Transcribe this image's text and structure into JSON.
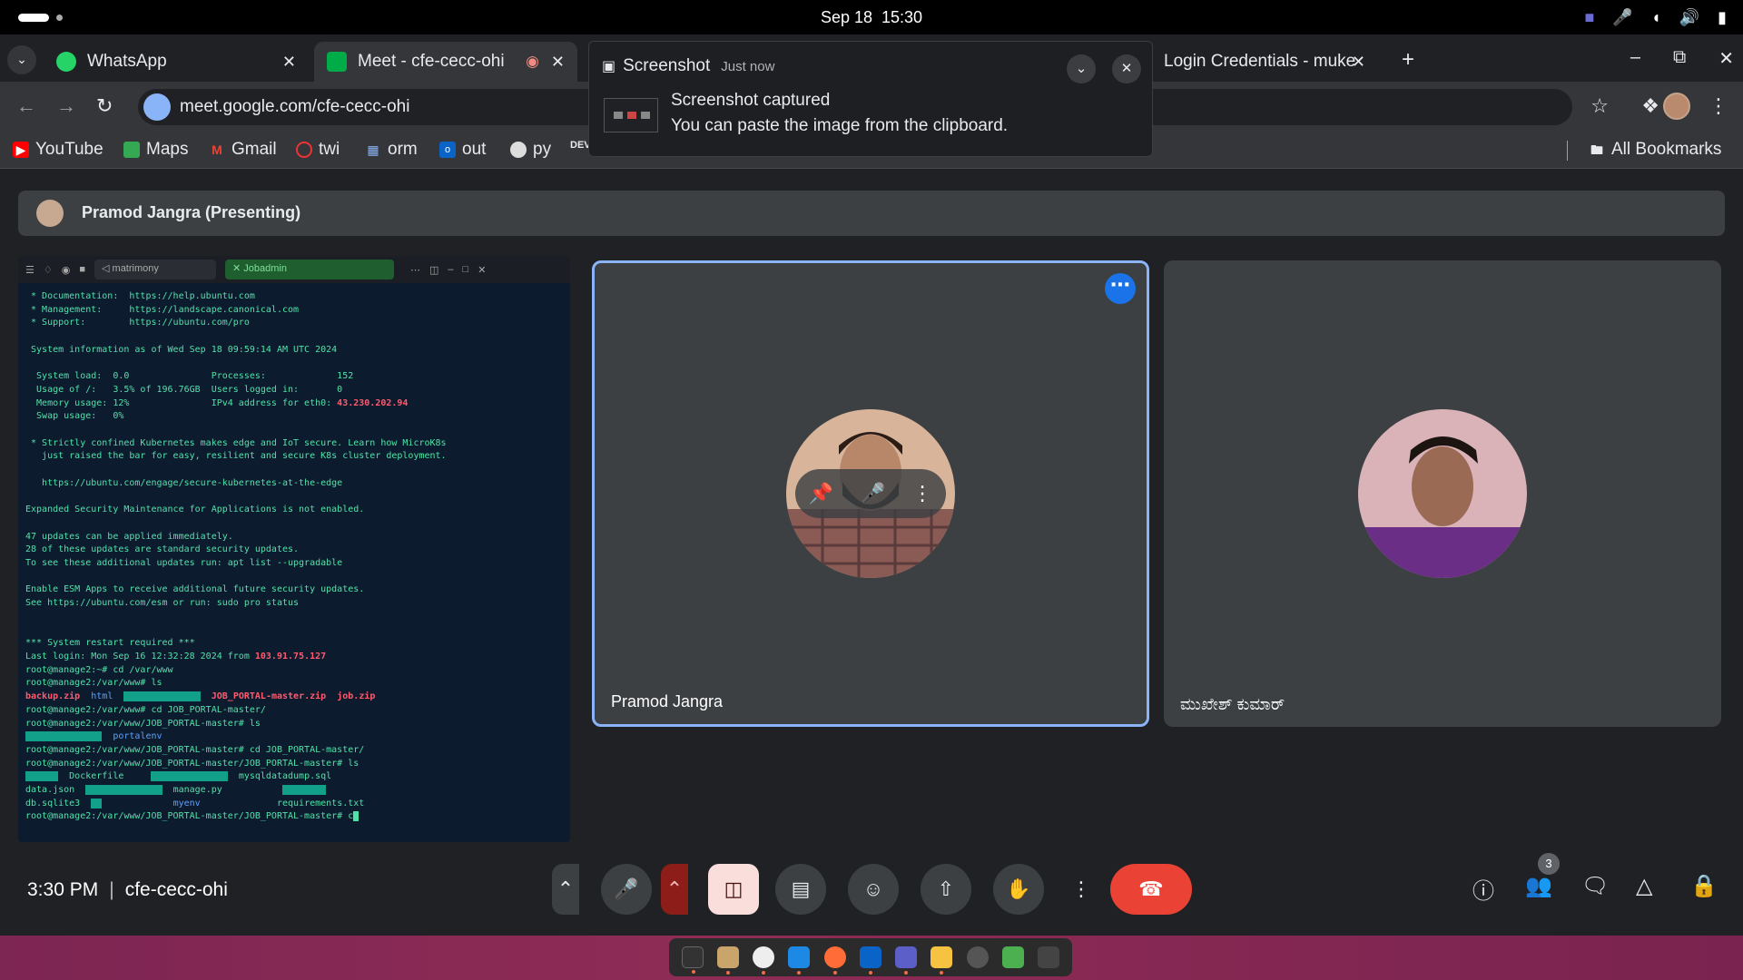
{
  "system": {
    "date": "Sep 18",
    "time": "15:30"
  },
  "browser": {
    "tabs": [
      {
        "label": "WhatsApp",
        "favicon": "whatsapp-icon"
      },
      {
        "label": "Meet - cfe-cecc-ohi",
        "favicon": "meet-icon",
        "recording": true
      },
      {
        "label": "Login Credentials - muke",
        "favicon": "doc-icon"
      }
    ],
    "url": "meet.google.com/cfe-cecc-ohi",
    "bookmarks": [
      "YouTube",
      "Maps",
      "Gmail",
      "twi",
      "orm",
      "out",
      "py"
    ],
    "dev_bookmark": "DEV",
    "all_bookmarks": "All Bookmarks"
  },
  "toast": {
    "app": "Screenshot",
    "time": "Just now",
    "title": "Screenshot captured",
    "body": "You can paste the image from the clipboard."
  },
  "meet": {
    "presenting": "Pramod Jangra (Presenting)",
    "participants": [
      {
        "name": "Pramod Jangra",
        "active": true
      },
      {
        "name": "ಮುಖೇಶ್ ಕುಮಾರ್"
      }
    ],
    "clock": "3:30 PM",
    "separator": "|",
    "code": "cfe-cecc-ohi",
    "participant_count": "3",
    "colors": {
      "accent": "#8ab4f8",
      "hangup": "#ea4335",
      "cam_off": "#f9dedc"
    }
  },
  "terminal": {
    "tab1": "matrimony",
    "tab2": "Jobadmin",
    "lines": [
      " * Documentation:  https://help.ubuntu.com",
      " * Management:     https://landscape.canonical.com",
      " * Support:        https://ubuntu.com/pro",
      "",
      " System information as of Wed Sep 18 09:59:14 AM UTC 2024",
      "",
      "  System load:  0.0               Processes:             152",
      "  Usage of /:   3.5% of 196.76GB  Users logged in:       0",
      "  Memory usage: 12%               IPv4 address for eth0: 43.230.202.94",
      "  Swap usage:   0%",
      "",
      " * Strictly confined Kubernetes makes edge and IoT secure. Learn how MicroK8s",
      "   just raised the bar for easy, resilient and secure K8s cluster deployment.",
      "",
      "   https://ubuntu.com/engage/secure-kubernetes-at-the-edge",
      "",
      "Expanded Security Maintenance for Applications is not enabled.",
      "",
      "47 updates can be applied immediately.",
      "28 of these updates are standard security updates.",
      "To see these additional updates run: apt list --upgradable",
      "",
      "Enable ESM Apps to receive additional future security updates.",
      "See https://ubuntu.com/esm or run: sudo pro status",
      "",
      "",
      "*** System restart required ***",
      "Last login: Mon Sep 16 12:32:28 2024 from 103.91.75.127",
      "root@manage2:~# cd /var/www",
      "root@manage2:/var/www# ls"
    ],
    "ls1": [
      "backup.zip",
      "html",
      "JOB_PORTAL-master.zip",
      "job.zip"
    ],
    "lines2": [
      "root@manage2:/var/www# cd JOB_PORTAL-master/",
      "root@manage2:/var/www/JOB_PORTAL-master# ls"
    ],
    "ls2": [
      "portalenv"
    ],
    "lines3": [
      "root@manage2:/var/www/JOB_PORTAL-master# cd JOB_PORTAL-master/",
      "root@manage2:/var/www/JOB_PORTAL-master/JOB_PORTAL-master# ls"
    ],
    "ls3": [
      "Dockerfile",
      "mysqldatadump.sql",
      "data.json",
      "manage.py",
      "db.sqlite3",
      "myenv",
      "requirements.txt"
    ],
    "prompt": "root@manage2:/var/www/JOB_PORTAL-master/JOB_PORTAL-master# c"
  }
}
